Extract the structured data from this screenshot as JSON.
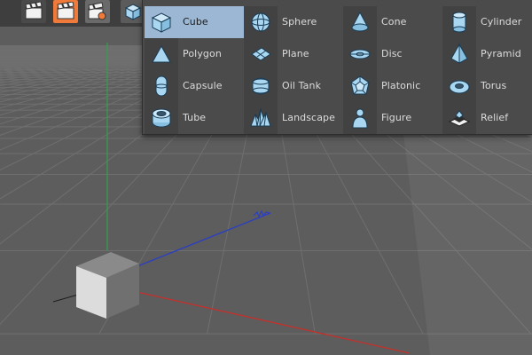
{
  "toolbar": {
    "buttons": [
      {
        "icon": "clapboard-icon"
      },
      {
        "icon": "render-view-icon"
      },
      {
        "icon": "render-settings-icon"
      },
      {
        "icon": "cube-object-icon"
      }
    ]
  },
  "object_menu": {
    "columns": [
      [
        {
          "label": "Cube",
          "icon": "cube-icon",
          "active": true
        },
        {
          "label": "Polygon",
          "icon": "polygon-icon"
        },
        {
          "label": "Capsule",
          "icon": "capsule-icon"
        },
        {
          "label": "Tube",
          "icon": "tube-icon"
        }
      ],
      [
        {
          "label": "Sphere",
          "icon": "sphere-icon"
        },
        {
          "label": "Plane",
          "icon": "plane-icon"
        },
        {
          "label": "Oil Tank",
          "icon": "oil-tank-icon"
        },
        {
          "label": "Landscape",
          "icon": "landscape-icon"
        }
      ],
      [
        {
          "label": "Cone",
          "icon": "cone-icon"
        },
        {
          "label": "Disc",
          "icon": "disc-icon"
        },
        {
          "label": "Platonic",
          "icon": "platonic-icon"
        },
        {
          "label": "Figure",
          "icon": "figure-icon"
        }
      ],
      [
        {
          "label": "Cylinder",
          "icon": "cylinder-icon"
        },
        {
          "label": "Pyramid",
          "icon": "pyramid-icon"
        },
        {
          "label": "Torus",
          "icon": "torus-icon"
        },
        {
          "label": "Relief",
          "icon": "relief-icon"
        }
      ]
    ]
  },
  "colors": {
    "viewport_bg": "#5d5d5d",
    "grid_line": "#6f6f6f",
    "menu_bg": "#4b4b4b",
    "menu_highlight": "#9cb7d3",
    "icon_fill": "#a9d6f0",
    "axis_x": "#c4302b",
    "axis_y": "#2fa34a",
    "axis_z": "#2c3fc0"
  }
}
